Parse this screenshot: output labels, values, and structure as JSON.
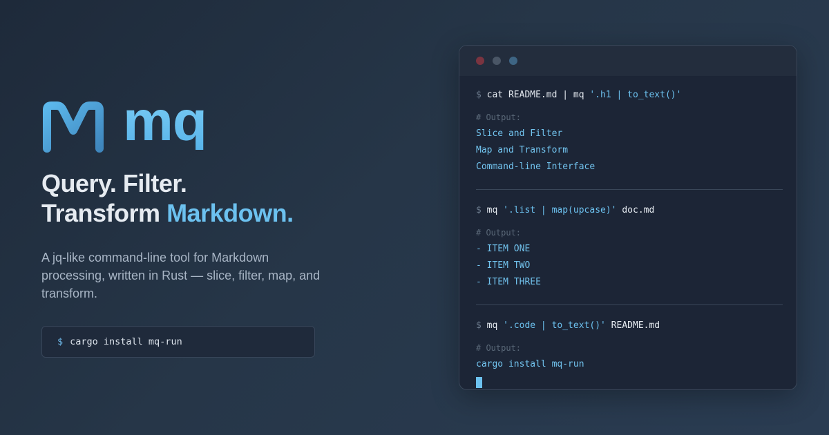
{
  "brand": {
    "name": "mq",
    "logo_icon": "mq-logo-icon",
    "colors": {
      "accent": "#6cc1ef",
      "background": "#263648",
      "terminal_bg": "#1c2536"
    }
  },
  "hero": {
    "headline_line1": "Query. Filter.",
    "headline_line2_plain": "Transform",
    "headline_line2_accent": "Markdown.",
    "subtitle": "A jq-like command-line tool for Markdown processing, written in Rust — slice, filter, map, and transform.",
    "install": {
      "prompt": "$",
      "command": "cargo install mq-run"
    }
  },
  "terminal": {
    "blocks": [
      {
        "prompt": "$",
        "cmd_before": "cat README.md | mq ",
        "cmd_query": "'.h1 | to_text()'",
        "cmd_after": "",
        "comment": "# Output:",
        "output": [
          "Slice and Filter",
          "Map and Transform",
          "Command-line Interface"
        ]
      },
      {
        "prompt": "$",
        "cmd_before": "mq ",
        "cmd_query": "'.list | map(upcase)'",
        "cmd_after": " doc.md",
        "comment": "# Output:",
        "output": [
          "- ITEM ONE",
          "- ITEM TWO",
          "- ITEM THREE"
        ]
      },
      {
        "prompt": "$",
        "cmd_before": "mq ",
        "cmd_query": "'.code | to_text()'",
        "cmd_after": " README.md",
        "comment": "# Output:",
        "output": [
          "cargo install mq-run"
        ]
      }
    ]
  }
}
